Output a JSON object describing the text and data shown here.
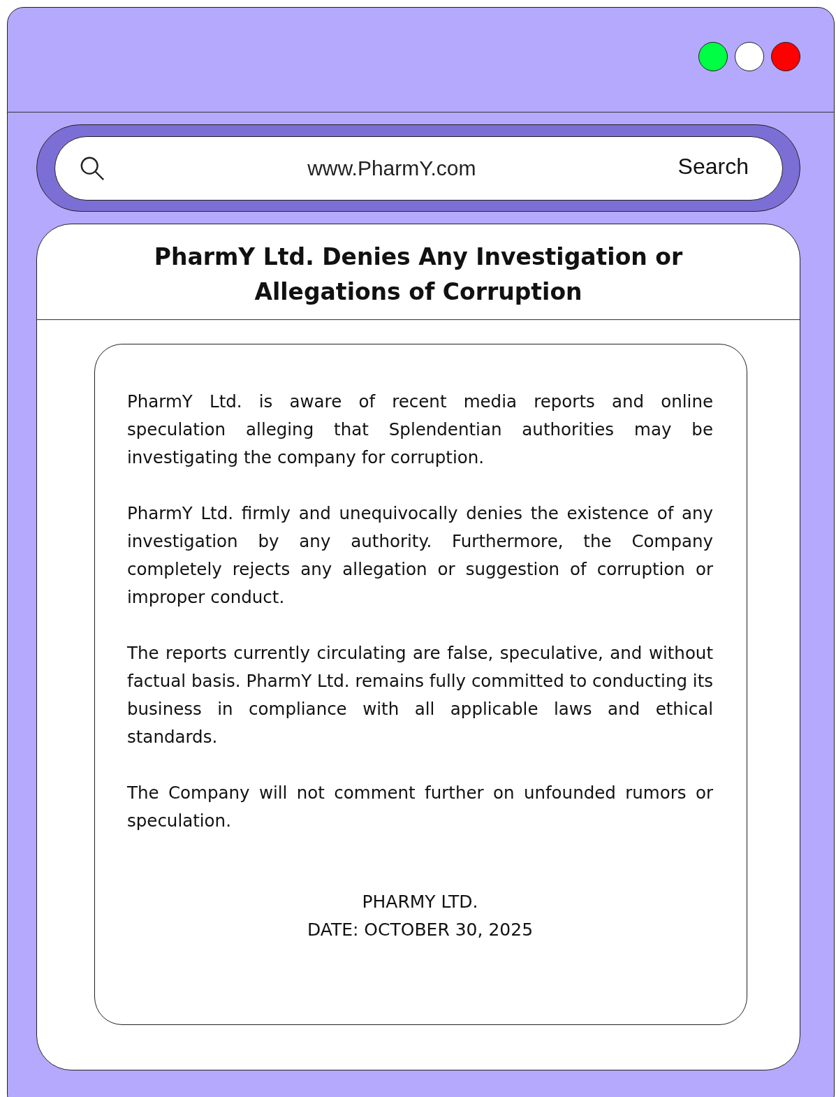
{
  "window": {
    "controls": [
      {
        "color": "#00ff44"
      },
      {
        "color": "#ffffff"
      },
      {
        "color": "#ff0000"
      }
    ]
  },
  "address_bar": {
    "url": "www.PharmY.com",
    "button": "Search"
  },
  "article": {
    "title": "PharmY Ltd. Denies Any Investigation or Allegations of Corruption",
    "paragraphs": [
      "PharmY Ltd. is aware of recent media reports and online speculation alleging that Splendentian authorities may be investigating the company for corruption.",
      "PharmY Ltd. firmly and unequivocally denies the existence of any investigation by any authority. Furthermore, the Company completely rejects any allegation or suggestion of corruption or improper conduct.",
      "The reports currently circulating are false, speculative, and without factual basis. PharmY Ltd. remains fully committed to conducting its business in compliance with all applicable laws and ethical standards.",
      "The Company will not comment further on unfounded rumors or speculation."
    ],
    "signature": [
      "PHARMY LTD.",
      "DATE: OCTOBER 30, 2025"
    ]
  }
}
